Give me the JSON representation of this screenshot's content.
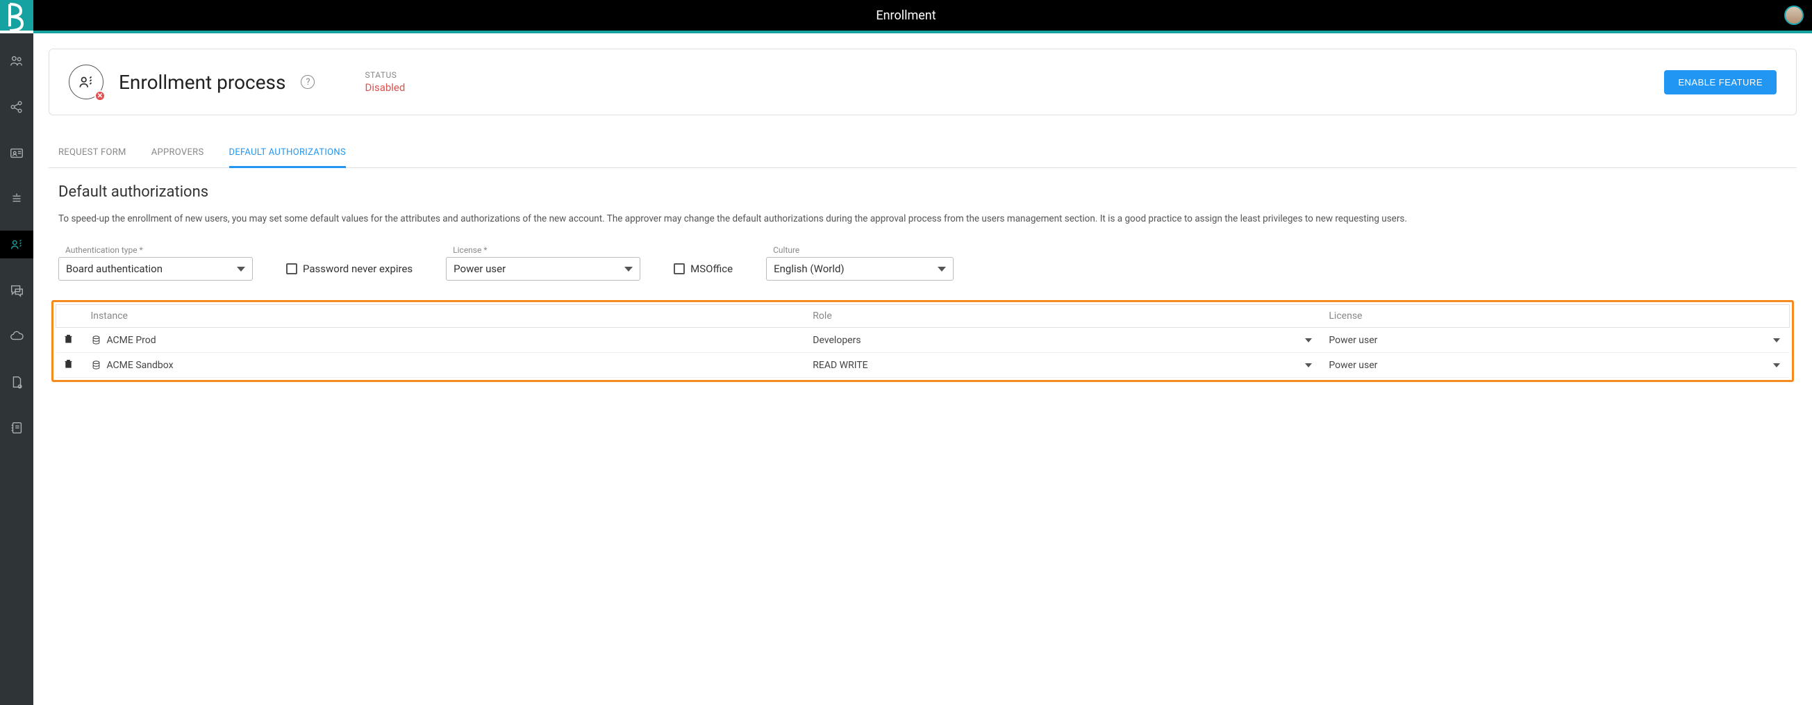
{
  "topbar": {
    "title": "Enrollment"
  },
  "card": {
    "title": "Enrollment process",
    "status_label": "STATUS",
    "status_value": "Disabled",
    "enable_button": "ENABLE FEATURE"
  },
  "tabs": [
    {
      "label": "REQUEST FORM",
      "active": false
    },
    {
      "label": "APPROVERS",
      "active": false
    },
    {
      "label": "DEFAULT AUTHORIZATIONS",
      "active": true
    }
  ],
  "section": {
    "title": "Default authorizations",
    "description": "To speed-up the enrollment of new users, you may set some default values for the attributes and authorizations of the new account. The approver may change the default authorizations during the approval process from the users management section. It is a good practice to assign the least privileges to new requesting users."
  },
  "form": {
    "auth_type_label": "Authentication type *",
    "auth_type_value": "Board authentication",
    "password_never_expires": "Password never expires",
    "license_label": "License *",
    "license_value": "Power user",
    "msoffice": "MSOffice",
    "culture_label": "Culture",
    "culture_value": "English (World)"
  },
  "table": {
    "headers": {
      "instance": "Instance",
      "role": "Role",
      "license": "License"
    },
    "rows": [
      {
        "instance": "ACME Prod",
        "role": "Developers",
        "license": "Power user"
      },
      {
        "instance": "ACME Sandbox",
        "role": "READ WRITE",
        "license": "Power user"
      }
    ]
  }
}
